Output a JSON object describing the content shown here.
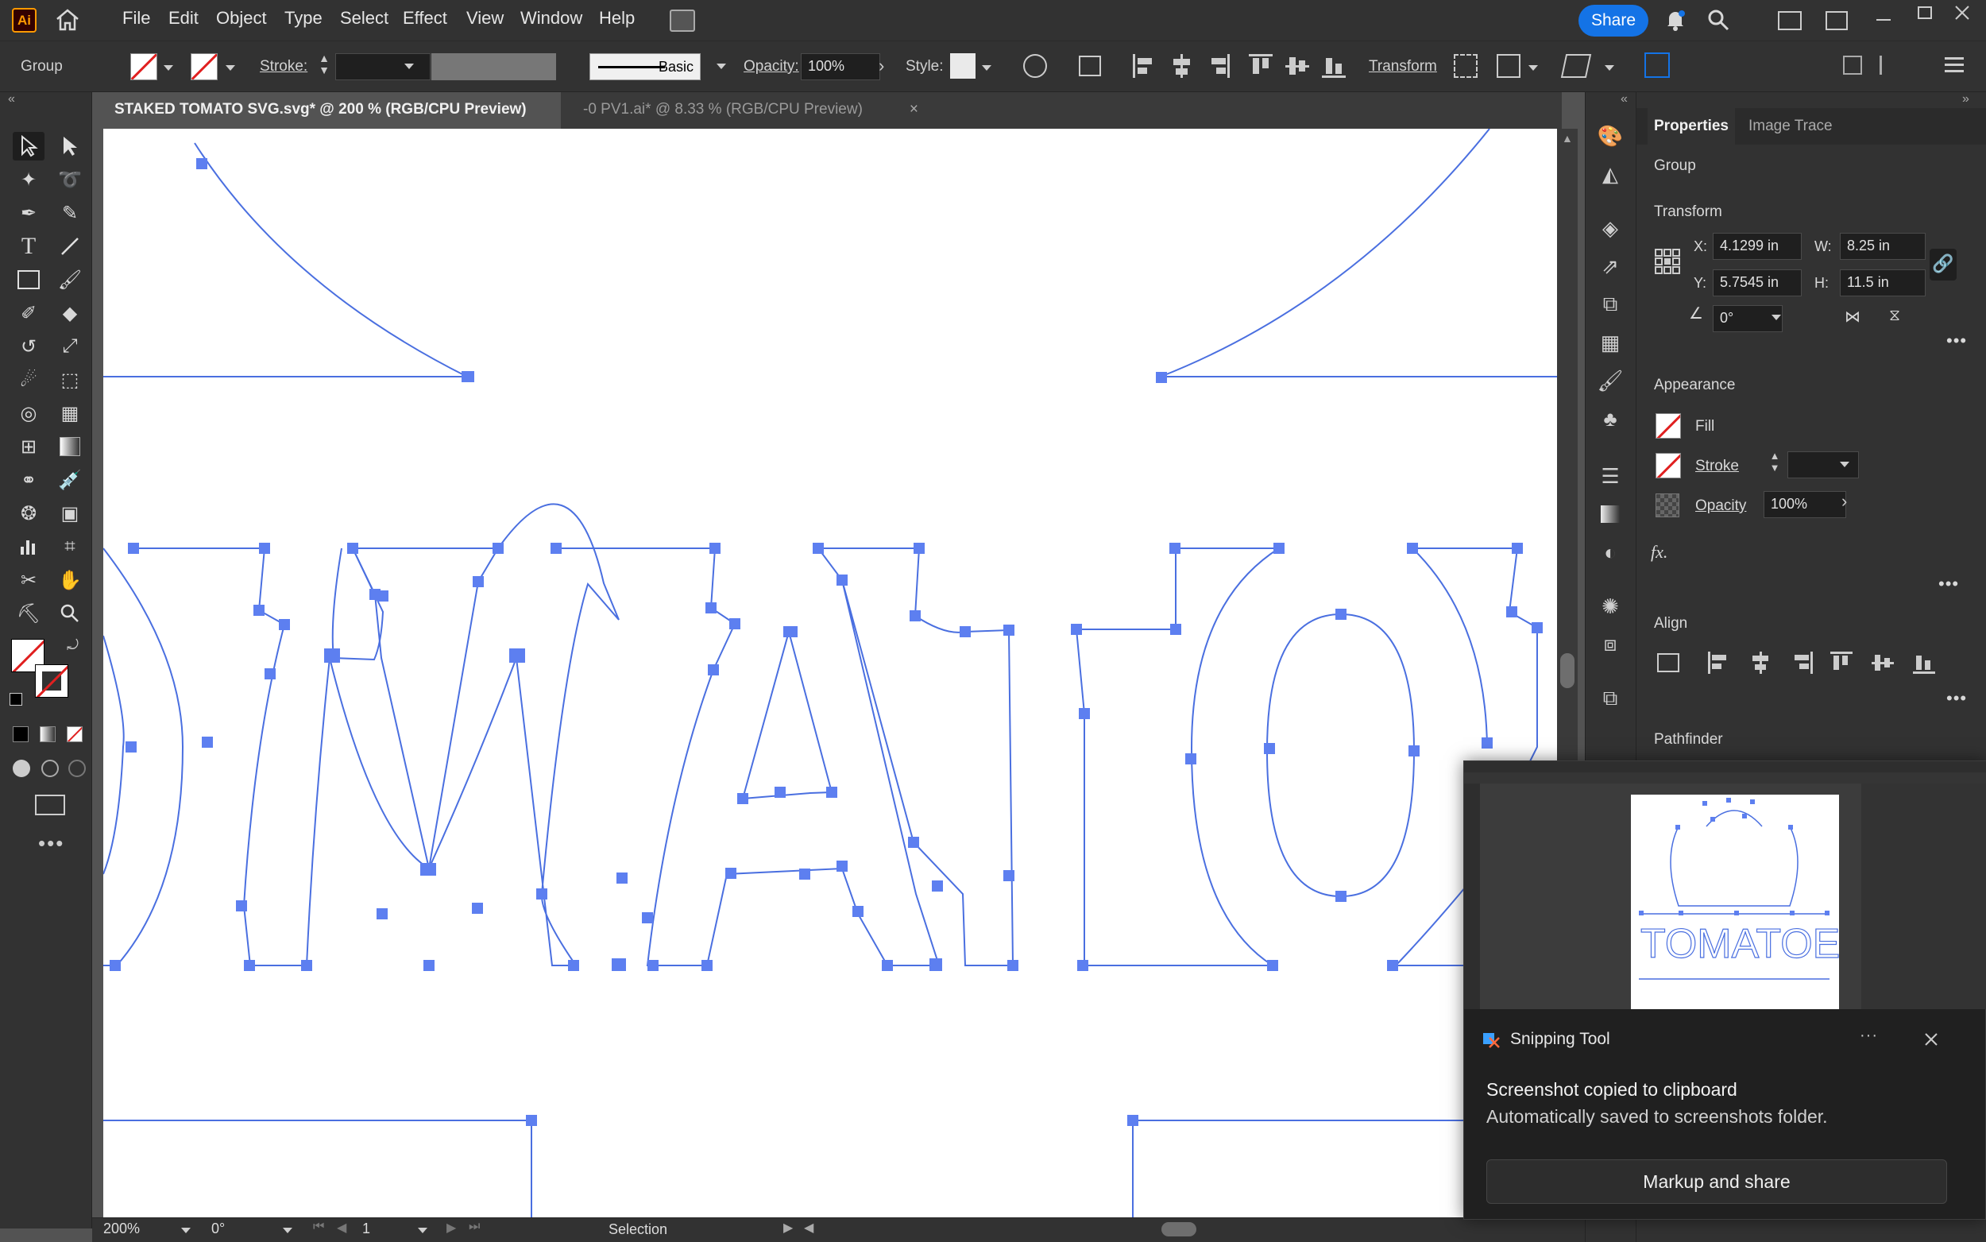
{
  "app": {
    "logo": "Ai"
  },
  "menu": [
    "File",
    "Edit",
    "Object",
    "Type",
    "Select",
    "Effect",
    "View",
    "Window",
    "Help"
  ],
  "share_label": "Share",
  "control_bar": {
    "selection_type": "Group",
    "stroke_label": "Stroke:",
    "brush_label": "Basic",
    "opacity_label": "Opacity:",
    "opacity_value": "100%",
    "style_label": "Style:",
    "transform_label": "Transform"
  },
  "tabs": [
    {
      "label": "STAKED TOMATO SVG.svg* @ 200 % (RGB/CPU Preview)",
      "active": true
    },
    {
      "label": "-0 PV1.ai* @ 8.33 % (RGB/CPU Preview)",
      "active": false
    }
  ],
  "status_bar": {
    "zoom": "200%",
    "rotation": "0°",
    "artboard": "1",
    "tool": "Selection"
  },
  "properties": {
    "tabs": [
      "Properties",
      "Image Trace"
    ],
    "selection": "Group",
    "transform": {
      "title": "Transform",
      "x_label": "X:",
      "x": "4.1299 in",
      "y_label": "Y:",
      "y": "5.7545 in",
      "w_label": "W:",
      "w": "8.25 in",
      "h_label": "H:",
      "h": "11.5 in",
      "angle": "0°"
    },
    "appearance": {
      "title": "Appearance",
      "fill_label": "Fill",
      "stroke_label": "Stroke",
      "opacity_label": "Opacity",
      "opacity_value": "100%",
      "fx_label": "fx."
    },
    "align_title": "Align",
    "pathfinder_title": "Pathfinder"
  },
  "toast": {
    "app_name": "Snipping Tool",
    "title": "Screenshot copied to clipboard",
    "subtitle": "Automatically saved to screenshots folder.",
    "button": "Markup and share"
  },
  "colors": {
    "path_stroke": "#4a6fe0",
    "anchor_fill": "#5d7ff0",
    "accent_blue": "#1473e6",
    "no_fill_red": "#e02020"
  }
}
